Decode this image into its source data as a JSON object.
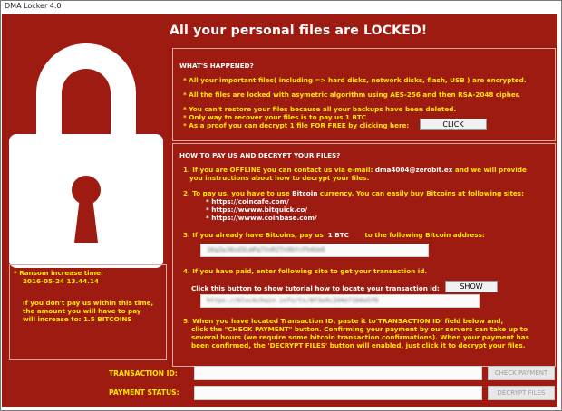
{
  "window": {
    "title": "DMA Locker 4.0"
  },
  "headline": "All your personal files are LOCKED!",
  "happened": {
    "title": "WHAT'S HAPPENED?",
    "line1": "* All your important files( including => hard disks, network disks, flash, USB ) are encrypted.",
    "line2": "* All the files are locked with asymetric algorithm using AES-256 and then RSA-2048 cipher.",
    "line3": "* You can't restore your files because all your backups have been deleted.",
    "line4": "* Only way to recover your files is to pay us  1 BTC",
    "line5": "* As a proof you can decrypt 1 file FOR FREE by clicking here:",
    "click_label": "CLICK"
  },
  "howto": {
    "title": "HOW TO PAY US AND DECRYPT YOUR FILES?",
    "step1a": "1. If you are OFFLINE you can contact us via e-mail:",
    "email": "dma4004@zerobit.ex",
    "step1b": "and we will provide",
    "step1c": "you instructions about how to decrypt your files.",
    "step2a": "2. To pay us, you have to use",
    "currency": "Bitcoin",
    "step2b": "currency. You can easily buy Bitcoins at following sites:",
    "sites": [
      "* https://coincafe.com/",
      "* https://wwww.bitquick.co/",
      "* https://wwww.coinbase.com/"
    ],
    "step3a": "3. If you already have Bitcoins, pay us",
    "amount": "1 BTC",
    "step3b": "to the following Bitcoin address:",
    "address_blur": "1KqZwJ8sd3LmPq7VxR2Tn9bYcFh4Ue6",
    "step4": "4. If you have paid, enter following site to get your transaction id.",
    "show_text": "Click this button to show tutorial how to locate your transaction id:",
    "show_label": "SHOW",
    "tutorial_blur": "https://blockchain.info/tx/8f3a9c2d4e71b0a5f6",
    "step5a": "5. When you have located Transaction ID, paste it to'TRANSACTION ID' field below and,",
    "step5b": "click the      \"CHECK PAYMENT\"    button. Confirming your payment by our servers can take up to",
    "step5c": "several hours (we require some bitcoin transaction confirmations). When your payment has",
    "step5d": "been confirmed, the 'DECRYPT FILES' button will enabled, just click it to decrypt your files."
  },
  "ransom": {
    "label": "* Ransom increase time:",
    "time": "2016-05-24 13.44.14",
    "note1": "If you don't pay us within this time,",
    "note2": "the amount you will have to pay",
    "note3": "will increase to:  1.5 BITCOINS"
  },
  "form": {
    "tx_label": "TRANSACTION ID:",
    "status_label": "PAYMENT STATUS:",
    "tx_value": "",
    "status_value": "",
    "check_label": "CHECK PAYMENT",
    "decrypt_label": "DECRYPT FILES"
  },
  "colors": {
    "background": "#9e1b12",
    "accent_text": "#ffe600",
    "border": "#d9a9a4"
  },
  "icons": {
    "lock": "padlock-icon"
  }
}
